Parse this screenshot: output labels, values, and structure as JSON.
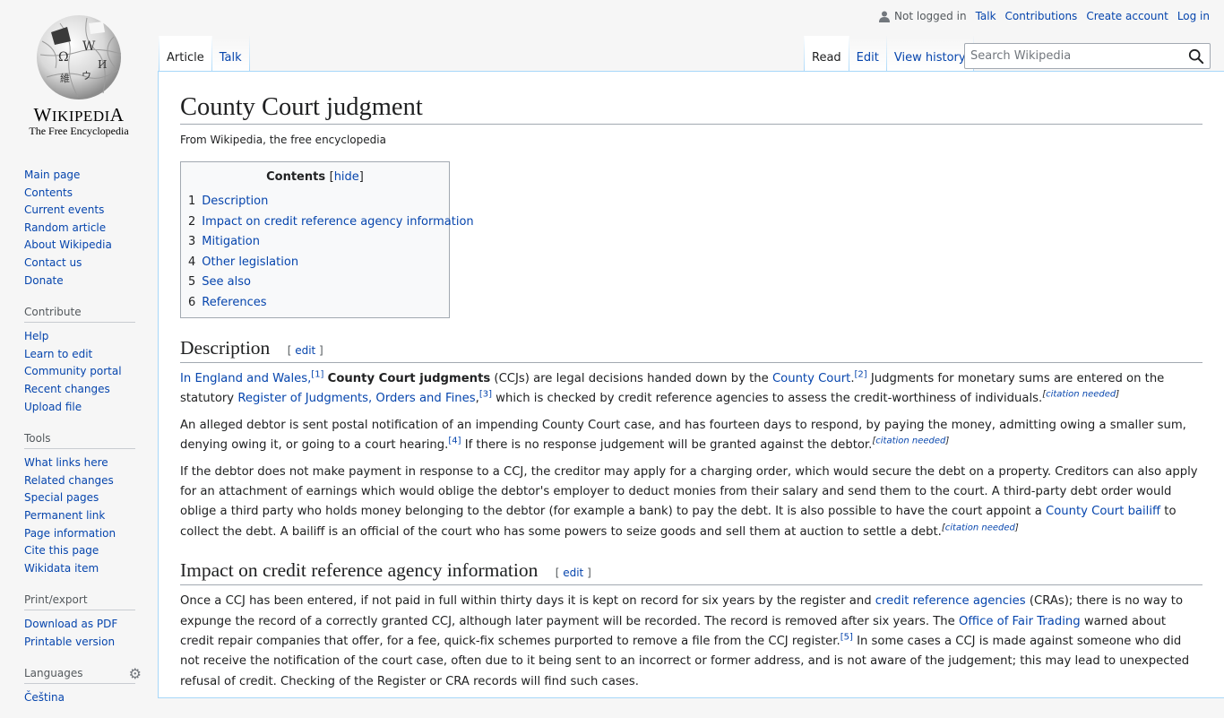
{
  "logo": {
    "wordmark": "Wikipedia",
    "tagline": "The Free Encyclopedia",
    "icon": "wikipedia-globe-icon"
  },
  "personal": {
    "anon": "Not logged in",
    "talk": "Talk",
    "contributions": "Contributions",
    "create_account": "Create account",
    "login": "Log in"
  },
  "tabs": {
    "article": "Article",
    "talk": "Talk",
    "read": "Read",
    "edit": "Edit",
    "history": "View history"
  },
  "search": {
    "placeholder": "Search Wikipedia",
    "icon": "search-icon"
  },
  "sidebar": {
    "navigation": [
      "Main page",
      "Contents",
      "Current events",
      "Random article",
      "About Wikipedia",
      "Contact us",
      "Donate"
    ],
    "contribute": {
      "heading": "Contribute",
      "items": [
        "Help",
        "Learn to edit",
        "Community portal",
        "Recent changes",
        "Upload file"
      ]
    },
    "tools": {
      "heading": "Tools",
      "items": [
        "What links here",
        "Related changes",
        "Special pages",
        "Permanent link",
        "Page information",
        "Cite this page",
        "Wikidata item"
      ]
    },
    "print": {
      "heading": "Print/export",
      "items": [
        "Download as PDF",
        "Printable version"
      ]
    },
    "languages": {
      "heading": "Languages",
      "items": [
        "Čeština"
      ],
      "icon": "gear-icon"
    }
  },
  "article": {
    "title": "County Court judgment",
    "site_sub": "From Wikipedia, the free encyclopedia",
    "toc": {
      "title": "Contents",
      "toggle": "hide",
      "items": [
        {
          "num": "1",
          "label": "Description"
        },
        {
          "num": "2",
          "label": "Impact on credit reference agency information"
        },
        {
          "num": "3",
          "label": "Mitigation"
        },
        {
          "num": "4",
          "label": "Other legislation"
        },
        {
          "num": "5",
          "label": "See also"
        },
        {
          "num": "6",
          "label": "References"
        }
      ]
    },
    "edit_label": "edit",
    "sections": {
      "description": {
        "heading": "Description",
        "p1": {
          "l1": "In England and Wales,",
          "r1": "[1]",
          "bold": "County Court judgments",
          "t1": " (CCJs) are legal decisions handed down by the ",
          "l2": "County Court",
          "t2": ".",
          "r2": "[2]",
          "t3": " Judgments for monetary sums are entered on the statutory ",
          "l3": "Register of Judgments, Orders and Fines",
          "t4": ",",
          "r3": "[3]",
          "t5": " which is checked by credit reference agencies to assess the credit-worthiness of individuals.",
          "cn": "citation needed"
        },
        "p2": {
          "t1": "An alleged debtor is sent postal notification of an impending County Court case, and has fourteen days to respond, by paying the money, admitting owing a smaller sum, denying owing it, or going to a court hearing.",
          "r1": "[4]",
          "t2": " If there is no response judgement will be granted against the debtor.",
          "cn": "citation needed"
        },
        "p3": {
          "t1": "If the debtor does not make payment in response to a CCJ, the creditor may apply for a charging order, which would secure the debt on a property. Creditors can also apply for an attachment of earnings which would oblige the debtor's employer to deduct monies from their salary and send them to the court. A third-party debt order would oblige a third party who holds money belonging to the debtor (for example a bank) to pay the debt. It is also possible to have the court appoint a ",
          "l1": "County Court bailiff",
          "t2": " to collect the debt. A bailiff is an official of the court who has some powers to seize goods and sell them at auction to settle a debt.",
          "cn": "citation needed"
        }
      },
      "impact": {
        "heading": "Impact on credit reference agency information",
        "p1": {
          "t1": "Once a CCJ has been entered, if not paid in full within thirty days it is kept on record for six years by the register and ",
          "l1": "credit reference agencies",
          "t2": " (CRAs); there is no way to expunge the record of a correctly granted CCJ, although later payment will be recorded. The record is removed after six years. The ",
          "l2": "Office of Fair Trading",
          "t3": " warned about credit repair companies that offer, for a fee, quick-fix schemes purported to remove a file from the CCJ register.",
          "r1": "[5]",
          "t4": " In some cases a CCJ is made against someone who did not receive the notification of the court case, often due to it being sent to an incorrect or former address, and is not aware of the judgement; this may lead to unexpected refusal of credit. Checking of the Register or CRA records will find such cases."
        }
      }
    }
  }
}
